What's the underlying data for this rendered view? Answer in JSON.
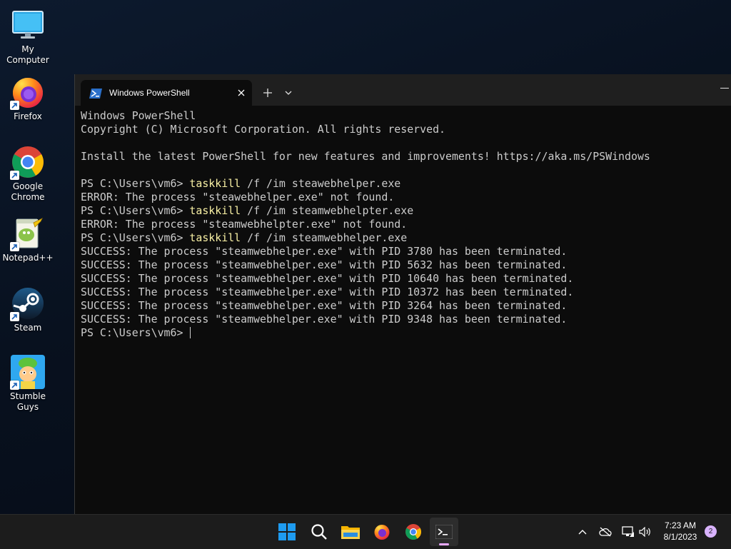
{
  "desktop": {
    "icons": [
      {
        "label": "My Computer",
        "icon": "monitor-icon"
      },
      {
        "label": "Firefox",
        "icon": "firefox-icon"
      },
      {
        "label": "Google Chrome",
        "icon": "chrome-icon"
      },
      {
        "label": "Notepad++",
        "icon": "notepadpp-icon"
      },
      {
        "label": "Steam",
        "icon": "steam-icon"
      },
      {
        "label": "Stumble Guys",
        "icon": "stumble-guys-icon"
      }
    ]
  },
  "window": {
    "tab_title": "Windows PowerShell",
    "tab_icon": "powershell-icon",
    "new_tab_icon": "plus-icon",
    "dropdown_icon": "chevron-down-icon"
  },
  "terminal": {
    "lines": [
      {
        "prompt": "",
        "cmd": "",
        "args": "",
        "text": "Windows PowerShell"
      },
      {
        "prompt": "",
        "cmd": "",
        "args": "",
        "text": "Copyright (C) Microsoft Corporation. All rights reserved."
      },
      {
        "prompt": "",
        "cmd": "",
        "args": "",
        "text": ""
      },
      {
        "prompt": "",
        "cmd": "",
        "args": "",
        "text": "Install the latest PowerShell for new features and improvements! https://aka.ms/PSWindows"
      },
      {
        "prompt": "",
        "cmd": "",
        "args": "",
        "text": ""
      },
      {
        "prompt": "PS C:\\Users\\vm6> ",
        "cmd": "taskkill",
        "args": " /f /im steawebhelper.exe",
        "text": ""
      },
      {
        "prompt": "",
        "cmd": "",
        "args": "",
        "text": "ERROR: The process \"steawebhelper.exe\" not found."
      },
      {
        "prompt": "PS C:\\Users\\vm6> ",
        "cmd": "taskkill",
        "args": " /f /im steamwebhelpter.exe",
        "text": ""
      },
      {
        "prompt": "",
        "cmd": "",
        "args": "",
        "text": "ERROR: The process \"steamwebhelpter.exe\" not found."
      },
      {
        "prompt": "PS C:\\Users\\vm6> ",
        "cmd": "taskkill",
        "args": " /f /im steamwebhelper.exe",
        "text": ""
      },
      {
        "prompt": "",
        "cmd": "",
        "args": "",
        "text": "SUCCESS: The process \"steamwebhelper.exe\" with PID 3780 has been terminated."
      },
      {
        "prompt": "",
        "cmd": "",
        "args": "",
        "text": "SUCCESS: The process \"steamwebhelper.exe\" with PID 5632 has been terminated."
      },
      {
        "prompt": "",
        "cmd": "",
        "args": "",
        "text": "SUCCESS: The process \"steamwebhelper.exe\" with PID 10640 has been terminated."
      },
      {
        "prompt": "",
        "cmd": "",
        "args": "",
        "text": "SUCCESS: The process \"steamwebhelper.exe\" with PID 10372 has been terminated."
      },
      {
        "prompt": "",
        "cmd": "",
        "args": "",
        "text": "SUCCESS: The process \"steamwebhelper.exe\" with PID 3264 has been terminated."
      },
      {
        "prompt": "",
        "cmd": "",
        "args": "",
        "text": "SUCCESS: The process \"steamwebhelper.exe\" with PID 9348 has been terminated."
      }
    ],
    "current_prompt": "PS C:\\Users\\vm6> ",
    "command_color": "#f9f1a5",
    "text_color": "#cccccc",
    "background": "#0c0c0c"
  },
  "taskbar": {
    "apps": [
      {
        "icon": "windows-start-icon",
        "active": false
      },
      {
        "icon": "search-icon",
        "active": false
      },
      {
        "icon": "file-explorer-icon",
        "active": false
      },
      {
        "icon": "firefox-icon",
        "active": false
      },
      {
        "icon": "chrome-icon",
        "active": false
      },
      {
        "icon": "terminal-icon",
        "active": true
      }
    ],
    "tray": [
      "chevron-up-icon",
      "onedrive-off-icon",
      "network-icon",
      "volume-icon"
    ],
    "time": "7:23 AM",
    "date": "8/1/2023",
    "notification_count": "2",
    "accent": "#d9b3ff"
  }
}
